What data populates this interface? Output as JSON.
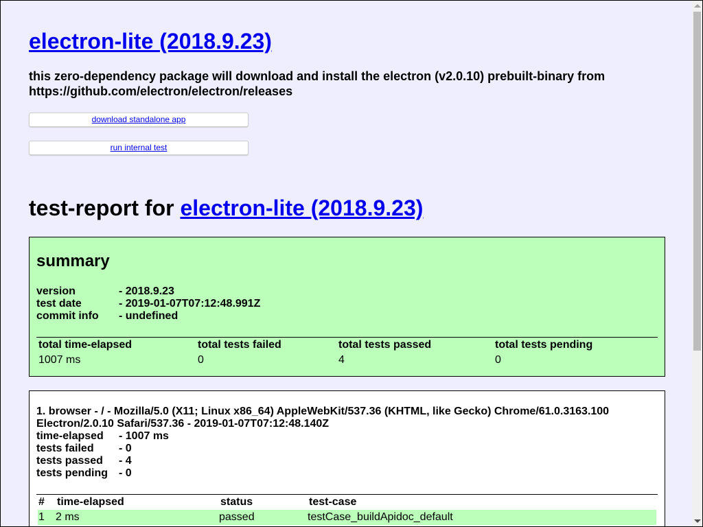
{
  "header": {
    "title": "electron-lite (2018.9.23)",
    "description": "this zero-dependency package will download and install the electron (v2.0.10) prebuilt-binary from https://github.com/electron/electron/releases"
  },
  "buttons": {
    "download": "download standalone app",
    "run_test": "run internal test"
  },
  "report": {
    "heading_prefix": "test-report for ",
    "heading_link": "electron-lite (2018.9.23)"
  },
  "summary": {
    "title": "summary",
    "fields": [
      {
        "key": "version",
        "value": "- 2018.9.23"
      },
      {
        "key": "test date",
        "value": "- 2019-01-07T07:12:48.991Z"
      },
      {
        "key": "commit info",
        "value": "- undefined"
      }
    ],
    "columns": [
      "total time-elapsed",
      "total tests failed",
      "total tests passed",
      "total tests pending"
    ],
    "values": [
      "1007 ms",
      "0",
      "4",
      "0"
    ]
  },
  "browser": {
    "title": "1. browser - / - Mozilla/5.0 (X11; Linux x86_64) AppleWebKit/537.36 (KHTML, like Gecko) Chrome/61.0.3163.100 Electron/2.0.10 Safari/537.36 - 2019-01-07T07:12:48.140Z",
    "fields": [
      {
        "key": "time-elapsed",
        "value": "- 1007 ms"
      },
      {
        "key": "tests failed",
        "value": "- 0"
      },
      {
        "key": "tests passed",
        "value": "- 4"
      },
      {
        "key": "tests pending",
        "value": "- 0"
      }
    ],
    "columns": [
      "#",
      "time-elapsed",
      "status",
      "test-case"
    ],
    "rows": [
      {
        "num": "1",
        "time": "2 ms",
        "status": "passed",
        "test_case": "testCase_buildApidoc_default"
      }
    ]
  }
}
